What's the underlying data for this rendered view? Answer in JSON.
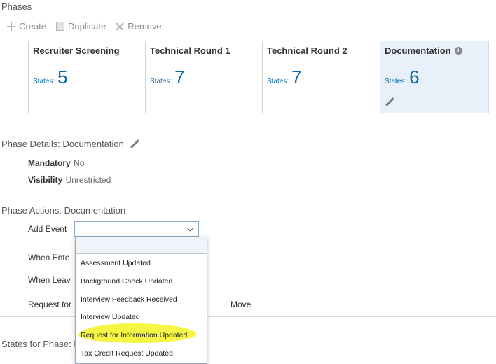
{
  "phases": {
    "title": "Phases",
    "toolbar": {
      "create": "Create",
      "duplicate": "Duplicate",
      "remove": "Remove"
    },
    "states_label": "States:",
    "cards": [
      {
        "name": "Recruiter Screening",
        "states": "5"
      },
      {
        "name": "Technical Round 1",
        "states": "7"
      },
      {
        "name": "Technical Round 2",
        "states": "7"
      },
      {
        "name": "Documentation",
        "states": "6"
      }
    ]
  },
  "details": {
    "title": "Phase Details: Documentation",
    "mandatory_label": "Mandatory",
    "mandatory_value": "No",
    "visibility_label": "Visibility",
    "visibility_value": "Unrestricted"
  },
  "actions": {
    "title": "Phase Actions: Documentation",
    "add_event_label": "Add Event",
    "select_value": "",
    "rows": [
      "When Ente",
      "When Leav",
      "Request for"
    ],
    "move_label": "Move"
  },
  "dropdown": {
    "options": [
      "Assessment Updated",
      "Background Check Updated",
      "Interview Feedback Received",
      "Interview Updated",
      "Request for Information Updated",
      "Tax Credit Request Updated"
    ],
    "highlight_color": "#f5f53b"
  },
  "states_section": {
    "title": "States for Phase: D"
  },
  "colors": {
    "accent": "#0a6aa1",
    "selected_card": "#e8f1fa"
  }
}
